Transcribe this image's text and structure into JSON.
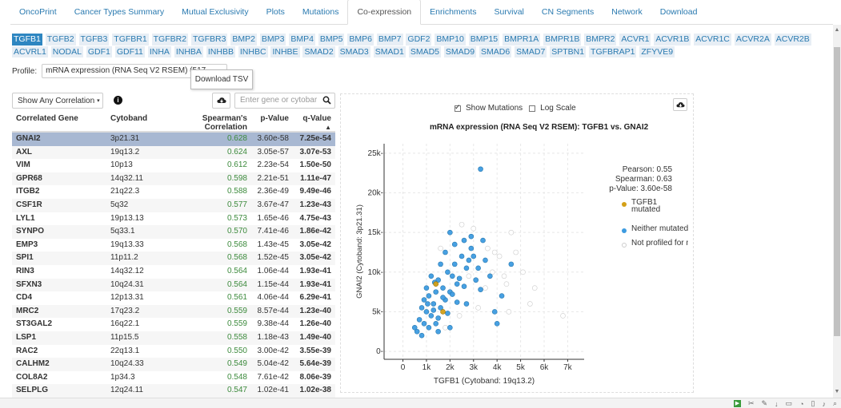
{
  "tabs": [
    "OncoPrint",
    "Cancer Types Summary",
    "Mutual Exclusivity",
    "Plots",
    "Mutations",
    "Co-expression",
    "Enrichments",
    "Survival",
    "CN Segments",
    "Network",
    "Download"
  ],
  "active_tab": "Co-expression",
  "genes": [
    "TGFB1",
    "TGFB2",
    "TGFB3",
    "TGFBR1",
    "TGFBR2",
    "TGFBR3",
    "BMP2",
    "BMP3",
    "BMP4",
    "BMP5",
    "BMP6",
    "BMP7",
    "GDF2",
    "BMP10",
    "BMP15",
    "BMPR1A",
    "BMPR1B",
    "BMPR2",
    "ACVR1",
    "ACVR1B",
    "ACVR1C",
    "ACVR2A",
    "ACVR2B",
    "ACVRL1",
    "NODAL",
    "GDF1",
    "GDF11",
    "INHA",
    "INHBA",
    "INHBB",
    "INHBC",
    "INHBE",
    "SMAD2",
    "SMAD3",
    "SMAD1",
    "SMAD5",
    "SMAD9",
    "SMAD6",
    "SMAD7",
    "SPTBN1",
    "TGFBRAP1",
    "ZFYVE9"
  ],
  "selected_gene": "TGFB1",
  "profile": {
    "label": "Profile:",
    "value": "mRNA expression (RNA Seq V2 RSEM) (517"
  },
  "tooltip": "Download TSV",
  "correlation_filter": "Show Any Correlation",
  "info_icon": "i",
  "search": {
    "placeholder": "Enter gene or cytobar"
  },
  "table": {
    "headers": {
      "gene": "Correlated Gene",
      "cytoband": "Cytoband",
      "spearman_line1": "Spearman's",
      "spearman_line2": "Correlation",
      "p": "p-Value",
      "q": "q-Value",
      "sort_arrow": "▲"
    },
    "rows": [
      {
        "gene": "GNAI2",
        "cyto": "3p21.31",
        "sp": "0.628",
        "p": "3.60e-58",
        "q": "7.25e-54"
      },
      {
        "gene": "AXL",
        "cyto": "19q13.2",
        "sp": "0.624",
        "p": "3.05e-57",
        "q": "3.07e-53"
      },
      {
        "gene": "VIM",
        "cyto": "10p13",
        "sp": "0.612",
        "p": "2.23e-54",
        "q": "1.50e-50"
      },
      {
        "gene": "GPR68",
        "cyto": "14q32.11",
        "sp": "0.598",
        "p": "2.21e-51",
        "q": "1.11e-47"
      },
      {
        "gene": "ITGB2",
        "cyto": "21q22.3",
        "sp": "0.588",
        "p": "2.36e-49",
        "q": "9.49e-46"
      },
      {
        "gene": "CSF1R",
        "cyto": "5q32",
        "sp": "0.577",
        "p": "3.67e-47",
        "q": "1.23e-43"
      },
      {
        "gene": "LYL1",
        "cyto": "19p13.13",
        "sp": "0.573",
        "p": "1.65e-46",
        "q": "4.75e-43"
      },
      {
        "gene": "SYNPO",
        "cyto": "5q33.1",
        "sp": "0.570",
        "p": "7.41e-46",
        "q": "1.86e-42"
      },
      {
        "gene": "EMP3",
        "cyto": "19q13.33",
        "sp": "0.568",
        "p": "1.43e-45",
        "q": "3.05e-42"
      },
      {
        "gene": "SPI1",
        "cyto": "11p11.2",
        "sp": "0.568",
        "p": "1.52e-45",
        "q": "3.05e-42"
      },
      {
        "gene": "RIN3",
        "cyto": "14q32.12",
        "sp": "0.564",
        "p": "1.06e-44",
        "q": "1.93e-41"
      },
      {
        "gene": "SFXN3",
        "cyto": "10q24.31",
        "sp": "0.564",
        "p": "1.15e-44",
        "q": "1.93e-41"
      },
      {
        "gene": "CD4",
        "cyto": "12p13.31",
        "sp": "0.561",
        "p": "4.06e-44",
        "q": "6.29e-41"
      },
      {
        "gene": "MRC2",
        "cyto": "17q23.2",
        "sp": "0.559",
        "p": "8.57e-44",
        "q": "1.23e-40"
      },
      {
        "gene": "ST3GAL2",
        "cyto": "16q22.1",
        "sp": "0.559",
        "p": "9.38e-44",
        "q": "1.26e-40"
      },
      {
        "gene": "LSP1",
        "cyto": "11p15.5",
        "sp": "0.558",
        "p": "1.18e-43",
        "q": "1.49e-40"
      },
      {
        "gene": "RAC2",
        "cyto": "22q13.1",
        "sp": "0.550",
        "p": "3.00e-42",
        "q": "3.55e-39"
      },
      {
        "gene": "CALHM2",
        "cyto": "10q24.33",
        "sp": "0.549",
        "p": "5.04e-42",
        "q": "5.64e-39"
      },
      {
        "gene": "COL8A2",
        "cyto": "1p34.3",
        "sp": "0.548",
        "p": "7.61e-42",
        "q": "8.06e-39"
      },
      {
        "gene": "SELPLG",
        "cyto": "12q24.11",
        "sp": "0.547",
        "p": "1.02e-41",
        "q": "1.02e-38"
      }
    ]
  },
  "plot": {
    "show_mutations_label": "Show Mutations",
    "show_mutations_checked": true,
    "log_scale_label": "Log Scale",
    "log_scale_checked": false,
    "stats": {
      "pearson": "Pearson: 0.55",
      "spearman": "Spearman: 0.63",
      "pvalue": "p-Value: 3.60e-58"
    },
    "legend": [
      "TGFB1 mutated",
      "Neither mutated",
      "Not profiled for m"
    ]
  },
  "colors": {
    "mutated": "#d4a017",
    "neither": "#3d9be0",
    "not_profiled": "#ffffff",
    "selected_row": "#a8b8d2",
    "link": "#2a7ab0"
  },
  "chart_data": {
    "type": "scatter",
    "title": "mRNA expression (RNA Seq V2 RSEM): TGFB1 vs. GNAI2",
    "xlabel": "TGFB1 (Cytoband: 19q13.2)",
    "ylabel": "GNAI2 (Cytoband: 3p21.31)",
    "xlim": [
      -800,
      7700
    ],
    "ylim": [
      -1000,
      26200
    ],
    "xticks": [
      0,
      1000,
      2000,
      3000,
      4000,
      5000,
      6000,
      7000
    ],
    "xticklabels": [
      "0",
      "1k",
      "2k",
      "3k",
      "4k",
      "5k",
      "6k",
      "7k"
    ],
    "yticks": [
      0,
      5000,
      10000,
      15000,
      20000,
      25000
    ],
    "yticklabels": [
      "0-",
      "5k-",
      "10k-",
      "15k-",
      "20k-",
      "25k-"
    ],
    "grid": true,
    "series": [
      {
        "name": "TGFB1 mutated",
        "points": [
          [
            1400,
            8500
          ],
          [
            1700,
            5000
          ]
        ]
      },
      {
        "name": "Neither mutated",
        "points": [
          [
            500,
            3000
          ],
          [
            700,
            4000
          ],
          [
            800,
            5500
          ],
          [
            900,
            6500
          ],
          [
            1000,
            5000
          ],
          [
            1100,
            7000
          ],
          [
            1200,
            4500
          ],
          [
            1300,
            6000
          ],
          [
            1400,
            7500
          ],
          [
            1500,
            9000
          ],
          [
            1600,
            5500
          ],
          [
            1700,
            8000
          ],
          [
            1800,
            6500
          ],
          [
            1900,
            10000
          ],
          [
            2000,
            7500
          ],
          [
            2100,
            9500
          ],
          [
            2200,
            11000
          ],
          [
            2300,
            8500
          ],
          [
            2500,
            12000
          ],
          [
            2700,
            10500
          ],
          [
            2900,
            13000
          ],
          [
            3100,
            9000
          ],
          [
            3300,
            23000
          ],
          [
            2000,
            15000
          ],
          [
            2900,
            14500
          ],
          [
            3400,
            14000
          ],
          [
            4600,
            11000
          ],
          [
            4200,
            7000
          ],
          [
            3900,
            5000
          ],
          [
            4000,
            3500
          ],
          [
            600,
            2500
          ],
          [
            900,
            3500
          ],
          [
            1100,
            3000
          ],
          [
            1300,
            5200
          ],
          [
            1500,
            4200
          ],
          [
            1700,
            6800
          ],
          [
            1900,
            4800
          ],
          [
            2100,
            7200
          ],
          [
            2300,
            6200
          ],
          [
            2400,
            9200
          ],
          [
            2600,
            8200
          ],
          [
            2800,
            11500
          ],
          [
            1000,
            8000
          ],
          [
            1200,
            9500
          ],
          [
            1600,
            11000
          ],
          [
            1800,
            12500
          ],
          [
            2200,
            13500
          ],
          [
            2600,
            14000
          ],
          [
            3000,
            12000
          ],
          [
            3200,
            10500
          ],
          [
            3500,
            11500
          ],
          [
            3700,
            9500
          ],
          [
            3300,
            7800
          ],
          [
            2700,
            6000
          ],
          [
            1500,
            2500
          ],
          [
            800,
            2000
          ],
          [
            1400,
            3500
          ],
          [
            2000,
            3000
          ],
          [
            1050,
            6000
          ],
          [
            1350,
            8700
          ]
        ]
      },
      {
        "name": "Not profiled for m",
        "points": [
          [
            3600,
            13000
          ],
          [
            4100,
            12000
          ],
          [
            3800,
            10000
          ],
          [
            4400,
            8500
          ],
          [
            4500,
            5000
          ],
          [
            5400,
            6000
          ],
          [
            4600,
            15000
          ],
          [
            3000,
            15500
          ],
          [
            2800,
            9500
          ],
          [
            3500,
            8000
          ],
          [
            5100,
            10000
          ],
          [
            6800,
            4500
          ],
          [
            5600,
            8000
          ],
          [
            2400,
            4500
          ],
          [
            1800,
            3000
          ],
          [
            3200,
            5500
          ],
          [
            4300,
            9500
          ],
          [
            2500,
            16000
          ],
          [
            1600,
            13000
          ],
          [
            3900,
            12500
          ],
          [
            4800,
            12500
          ]
        ]
      }
    ]
  }
}
